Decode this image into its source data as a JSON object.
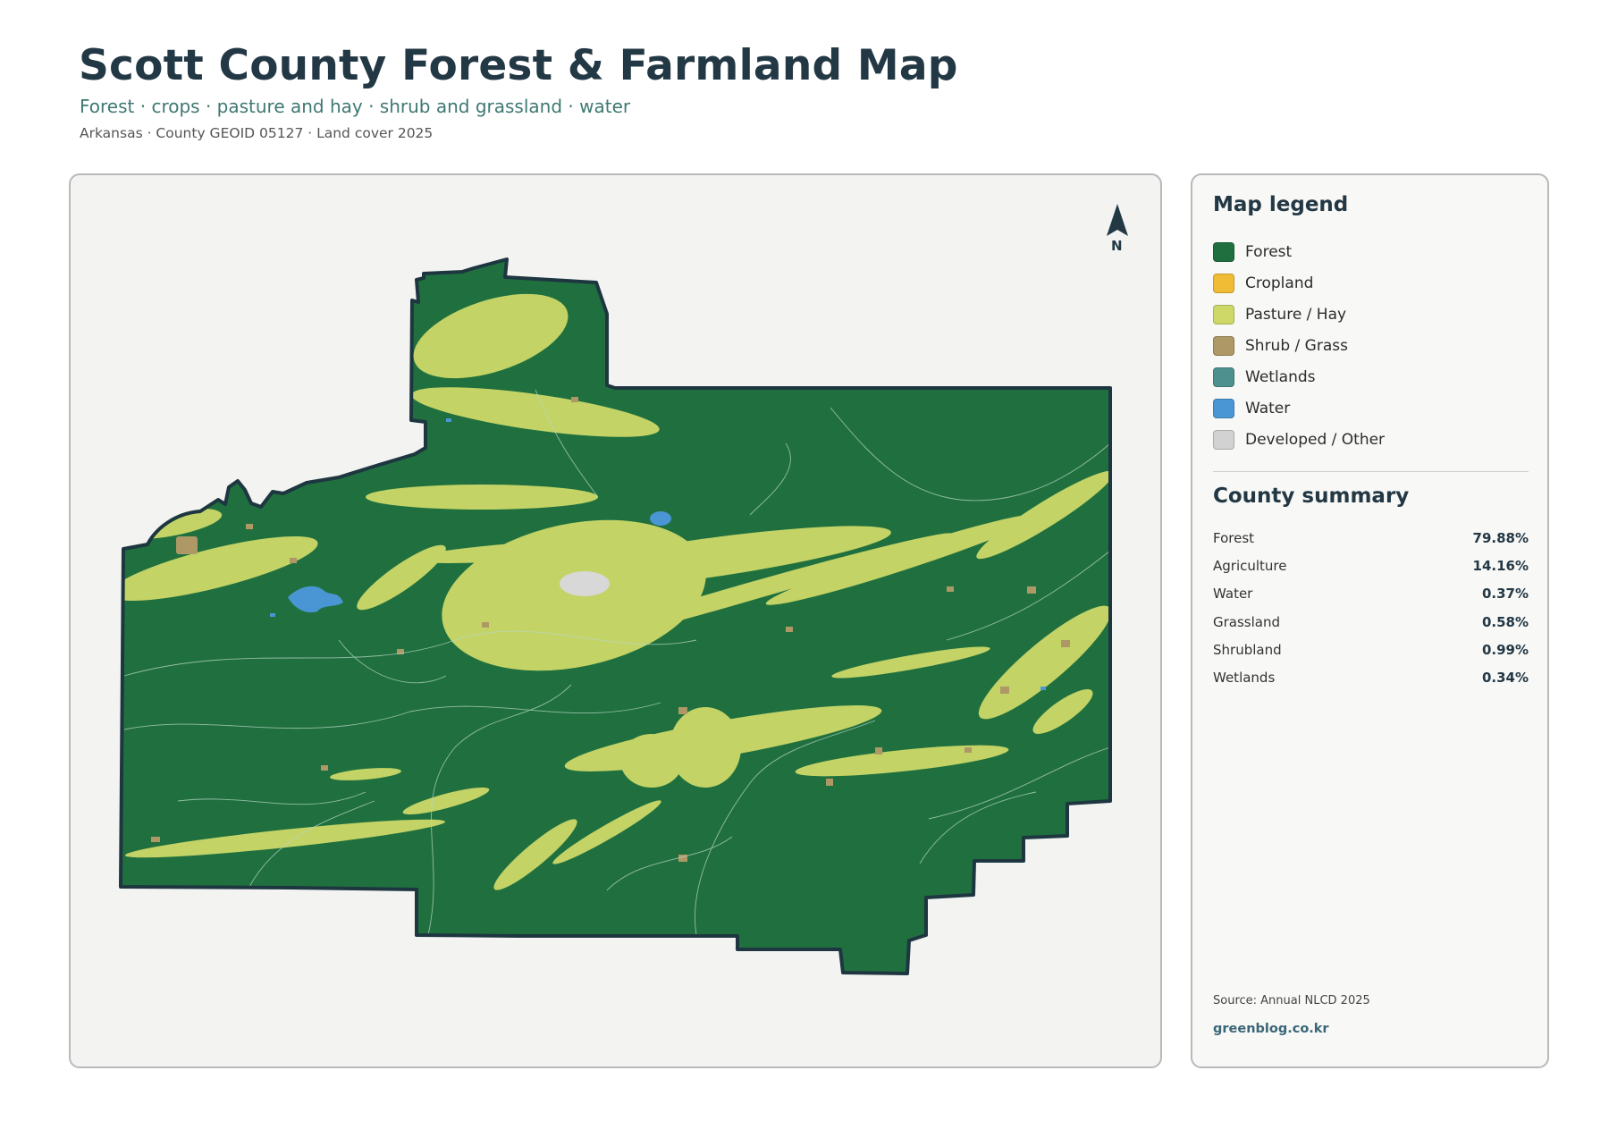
{
  "header": {
    "title": "Scott County Forest & Farmland Map",
    "subtitle": "Forest · crops · pasture and hay · shrub and grassland · water",
    "meta": "Arkansas · County GEOID 05127 · Land cover 2025"
  },
  "map": {
    "north_label": "N",
    "colors": {
      "forest": "#20703f",
      "pasture": "#cdd869",
      "shrub": "#ad9866",
      "water": "#4a96d4",
      "developed": "#d2d2d2",
      "boundary": "#1d3640"
    }
  },
  "legend": {
    "title": "Map legend",
    "items": [
      {
        "label": "Forest",
        "color": "#20703f"
      },
      {
        "label": "Cropland",
        "color": "#f0bb35"
      },
      {
        "label": "Pasture / Hay",
        "color": "#cdd869"
      },
      {
        "label": "Shrub / Grass",
        "color": "#ad9866"
      },
      {
        "label": "Wetlands",
        "color": "#4e908d"
      },
      {
        "label": "Water",
        "color": "#4a96d4"
      },
      {
        "label": "Developed / Other",
        "color": "#d2d2d2"
      }
    ]
  },
  "summary": {
    "title": "County summary",
    "rows": [
      {
        "label": "Forest",
        "value": "79.88%"
      },
      {
        "label": "Agriculture",
        "value": "14.16%"
      },
      {
        "label": "Water",
        "value": "0.37%"
      },
      {
        "label": "Grassland",
        "value": "0.58%"
      },
      {
        "label": "Shrubland",
        "value": "0.99%"
      },
      {
        "label": "Wetlands",
        "value": "0.34%"
      }
    ]
  },
  "footer": {
    "source": "Source: Annual NLCD 2025",
    "site": "greenblog.co.kr"
  }
}
